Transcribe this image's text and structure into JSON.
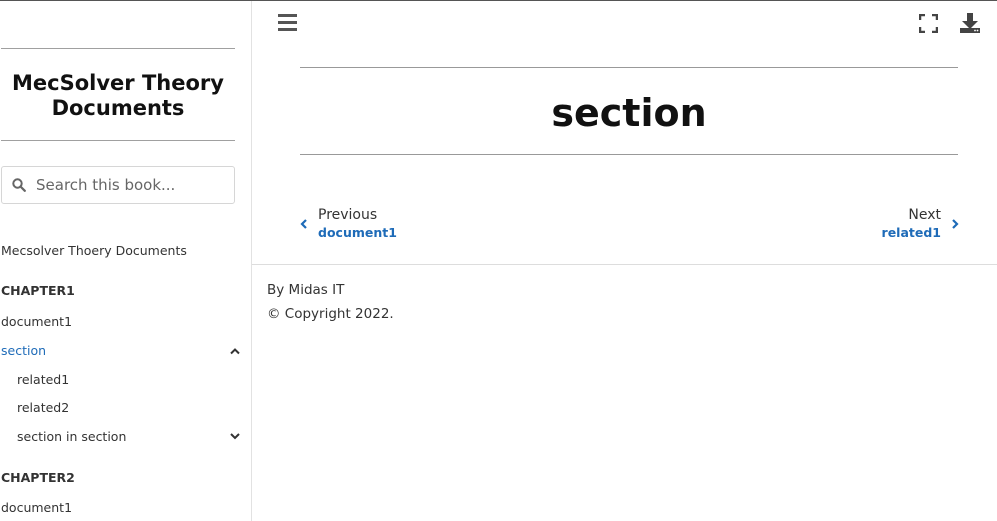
{
  "sidebar": {
    "book_title": "MecSolver Theory Documents",
    "search_placeholder": "Search this book...",
    "root_link": "Mecsolver Thoery Documents",
    "chapters": [
      {
        "title": "CHAPTER1"
      },
      {
        "title": "CHAPTER2"
      }
    ],
    "items": {
      "ch1_document1": "document1",
      "section": "section",
      "related1": "related1",
      "related2": "related2",
      "section_in_section": "section in section",
      "ch2_document1": "document1"
    }
  },
  "main": {
    "page_title": "section",
    "prev": {
      "caption": "Previous",
      "target": "document1"
    },
    "next": {
      "caption": "Next",
      "target": "related1"
    }
  },
  "footer": {
    "author": "By Midas IT",
    "copyright": "© Copyright 2022."
  },
  "colors": {
    "accent": "#1e6bb8",
    "text": "#333333"
  },
  "icons": [
    "search-icon",
    "chevron-up-icon",
    "chevron-down-icon",
    "menu-icon",
    "fullscreen-icon",
    "download-icon",
    "chevron-left-icon",
    "chevron-right-icon"
  ]
}
